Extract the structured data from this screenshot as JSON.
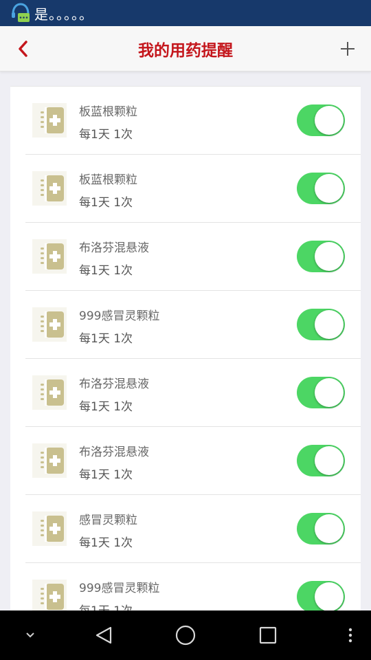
{
  "status_bar": {
    "text": "是。。。。。"
  },
  "header": {
    "title": "我的用药提醒"
  },
  "reminders": [
    {
      "name": "板蓝根颗粒",
      "frequency": "每1天 1次",
      "enabled": true
    },
    {
      "name": "板蓝根颗粒",
      "frequency": "每1天 1次",
      "enabled": true
    },
    {
      "name": "布洛芬混悬液",
      "frequency": "每1天 1次",
      "enabled": true
    },
    {
      "name": "999感冒灵颗粒",
      "frequency": "每1天 1次",
      "enabled": true
    },
    {
      "name": "布洛芬混悬液",
      "frequency": "每1天 1次",
      "enabled": true
    },
    {
      "name": "布洛芬混悬液",
      "frequency": "每1天 1次",
      "enabled": true
    },
    {
      "name": "感冒灵颗粒",
      "frequency": "每1天 1次",
      "enabled": true
    },
    {
      "name": "999感冒灵颗粒",
      "frequency": "每1天 1次",
      "enabled": true
    }
  ],
  "colors": {
    "accent": "#c4161c",
    "toggle_on": "#4cd664",
    "status_bar": "#17396b",
    "icon": "#c9c08f"
  },
  "icons": {
    "back": "chevron-left-icon",
    "add": "plus-icon",
    "medicine": "medicine-box-icon"
  }
}
